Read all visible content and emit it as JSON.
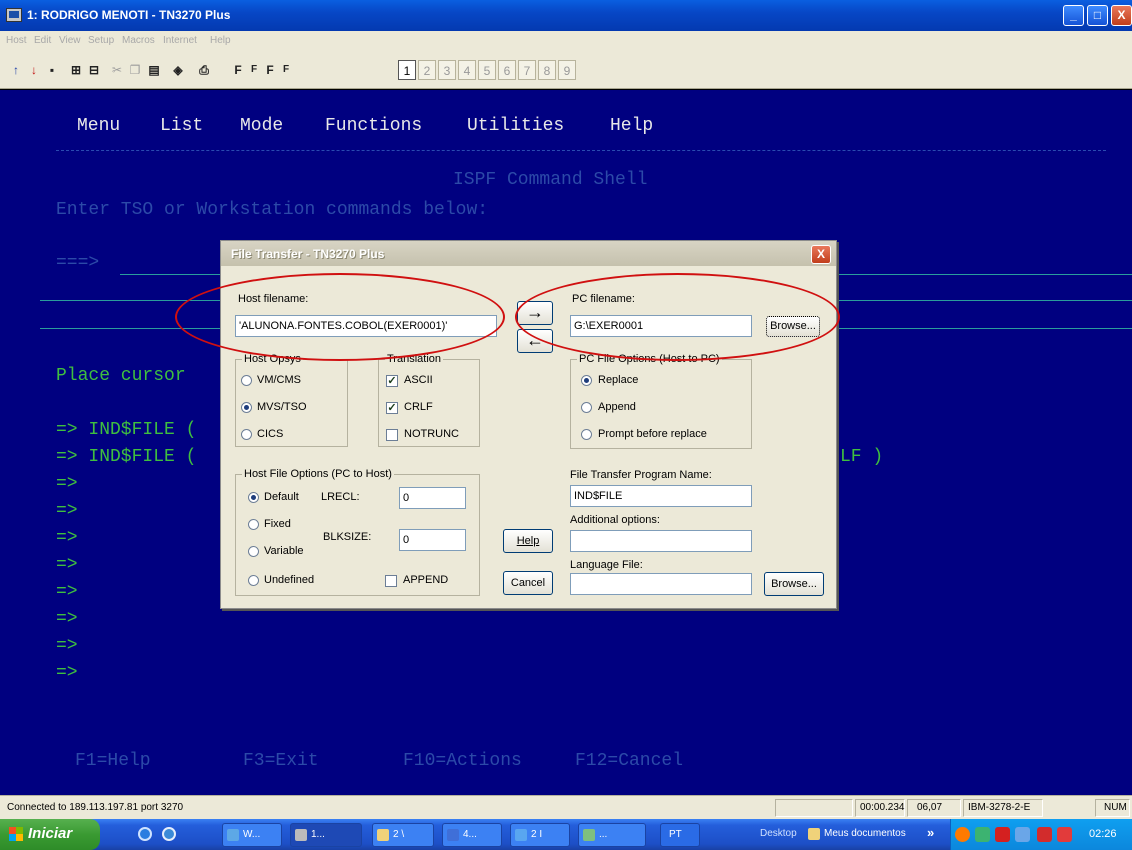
{
  "window": {
    "title": "1: RODRIGO MENOTI - TN3270 Plus",
    "min": "_",
    "max": "□",
    "close": "X"
  },
  "menu": [
    "Host",
    "Edit",
    "View",
    "Setup",
    "Macros",
    "Internet",
    "Help"
  ],
  "toolbar": {
    "icons": [
      "upload-arrow-icon",
      "download-arrow-icon",
      "save-icon",
      "copy-screen-icon",
      "paste-icon",
      "cut-icon",
      "copy-icon",
      "paste-doc-icon",
      "fullscreen-icon",
      "print-icon"
    ],
    "font_buttons": [
      "F",
      "F",
      "F",
      "F"
    ],
    "sessions": [
      "1",
      "2",
      "3",
      "4",
      "5",
      "6",
      "7",
      "8",
      "9"
    ]
  },
  "terminal": {
    "menubar": [
      "Menu",
      "List",
      "Mode",
      "Functions",
      "Utilities",
      "Help"
    ],
    "title": "ISPF Command Shell",
    "instruction": "Enter TSO or Workstation commands below:",
    "prompt": "===>",
    "place_cursor": "Place cursor",
    "cmd1": "=> IND$FILE (",
    "cmd2": "=> IND$FILE (",
    "cmd2_tail": "LF )",
    "arrow": "=>",
    "fkeys": [
      "F1=Help",
      "F3=Exit",
      "F10=Actions",
      "F12=Cancel"
    ]
  },
  "dialog": {
    "title": "File Transfer - TN3270 Plus",
    "close": "X",
    "host_filename_label": "Host filename:",
    "host_filename_value": "'ALUNONA.FONTES.COBOL(EXER0001)'",
    "pc_filename_label": "PC filename:",
    "pc_filename_value": "G:\\EXER0001",
    "browse": "Browse...",
    "send_arrow": "→",
    "receive_arrow": "←",
    "host_opsys": {
      "title": "Host Opsys",
      "options": [
        "VM/CMS",
        "MVS/TSO",
        "CICS"
      ],
      "selected": "MVS/TSO"
    },
    "translation": {
      "title": "Translation",
      "options": [
        {
          "label": "ASCII",
          "checked": true
        },
        {
          "label": "CRLF",
          "checked": true
        },
        {
          "label": "NOTRUNC",
          "checked": false
        }
      ]
    },
    "pc_file_options": {
      "title": "PC File Options (Host to PC)",
      "options": [
        "Replace",
        "Append",
        "Prompt before replace"
      ],
      "selected": "Replace"
    },
    "host_file_options": {
      "title": "Host File Options (PC to Host)",
      "options": [
        "Default",
        "Fixed",
        "Variable",
        "Undefined"
      ],
      "selected": "Default",
      "lrecl_label": "LRECL:",
      "lrecl_value": "0",
      "blksize_label": "BLKSIZE:",
      "blksize_value": "0",
      "append_label": "APPEND"
    },
    "program_name_label": "File Transfer Program Name:",
    "program_name_value": "IND$FILE",
    "additional_options_label": "Additional options:",
    "additional_options_value": "",
    "language_file_label": "Language File:",
    "language_file_value": "",
    "help": "Help",
    "cancel": "Cancel"
  },
  "statusbar": {
    "connection": "Connected to 189.113.197.81 port 3270",
    "timer": "00:00.234",
    "cursor": "06,07",
    "model": "IBM-3278-2-E",
    "num": "NUM"
  },
  "taskbar": {
    "start": "Iniciar",
    "tasks": [
      "W...",
      "1...",
      "2 \\",
      "4...",
      "2 I",
      "...",
      "PT"
    ],
    "desktop": "Desktop",
    "documents": "Meus documentos",
    "chevron": "»",
    "clock": "02:26"
  }
}
